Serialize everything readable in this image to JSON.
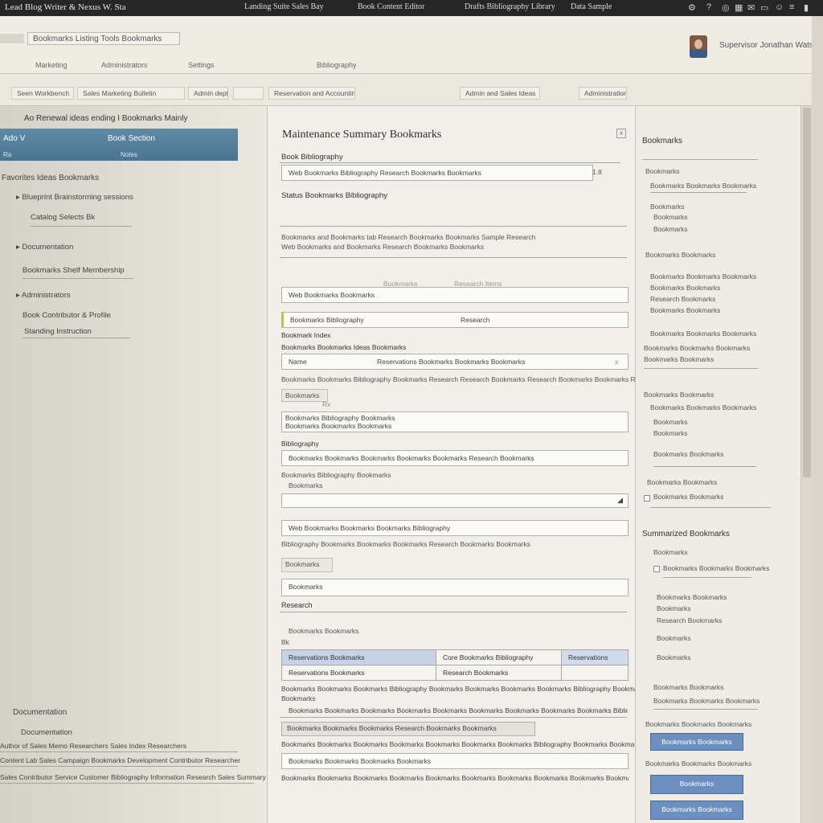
{
  "topbar": {
    "app_title": "Lead Blog Writer & Nexus W. Sta",
    "menus": [
      "Landing Suite Sales Bay",
      "Book Content Editor",
      "Drafts Bibliography Library",
      "Data Sample"
    ],
    "icons": [
      "settings-icon",
      "help-icon",
      "globe-icon",
      "grid-icon",
      "mail-icon",
      "window-icon",
      "user-icon",
      "lock-icon"
    ]
  },
  "header": {
    "search_text": "Bookmarks Listing Tools Bookmarks",
    "links": [
      "Marketing",
      "Administrators",
      "Settings",
      "Bibliography"
    ],
    "user_name": "Supervisor Jonathan Watson"
  },
  "tabs": [
    "Seen Workbench",
    "Sales Marketing Bulletin",
    "Admin dept",
    "Reservation and Accounting Tools",
    "Admin and Sales Ideas",
    "Administration Sales"
  ],
  "sidebar": {
    "title": "Ao Renewal ideas ending I Bookmarks Mainly",
    "active_primary": "Ado V",
    "active_secondary": "Book Section",
    "active_sub1": "Ra",
    "active_sub2": "Notes",
    "section_title": "Favorites Ideas Bookmarks",
    "items": [
      "Blueprint Brainstorming sessions",
      "Catalog Selects Bk",
      "Documentation",
      "Bookmarks Shelf Membership",
      "Administrators",
      "Book Contributor & Profile",
      "Standing Instruction"
    ],
    "footer_title": "Documentation",
    "footer_sub": "Documentation",
    "footer_lines": [
      "Author of Sales Memo Researchers Sales Index Researchers",
      "Content Lab Sales Campaign Bookmarks Development Contributor Researcher",
      "Sales Contributor Service Customer Bibliography Information Research Sales Summary"
    ]
  },
  "form": {
    "title": "Maintenance Summary Bookmarks",
    "close": "x",
    "label_a": "Book Bibliography",
    "field_a": "Web Bookmarks Bibliography Research Bookmarks Bookmarks",
    "field_a_suffix": "1.8",
    "label_b": "Status Bookmarks Bibliography",
    "desc_1": "Bookmarks and Bookmarks tab Research Bookmarks Bookmarks Sample Research",
    "desc_2": "Web Bookmarks and Bookmarks Research Bookmarks Bookmarks",
    "mini_1": "Bookmarks",
    "mini_2": "Research Items",
    "field_b": "Web Bookmarks Bookmarks",
    "field_c": "Bookmarks Bibliography",
    "field_c_right": "Research",
    "label_c": "Bookmark Index",
    "label_d": "Bookmarks Bookmarks Ideas Bookmarks",
    "field_d_left": "Name",
    "field_d_mid": "Reservations Bookmarks Bookmarks Bookmarks",
    "field_d_right": "x",
    "note_1": "Bookmarks Bookmarks Bibliography Bookmarks Research Research Bookmarks Research Bookmarks Bookmarks Research",
    "sub_btn": "Bookmarks",
    "subline": "Rx",
    "field_e_1": "Bookmarks Bibliography Bookmarks",
    "field_e_2": "Bookmarks Bookmarks Bookmarks",
    "label_e": "Bibliography",
    "field_f": "Bookmarks Bookmarks Bookmarks Bookmarks Bookmarks Research Bookmarks",
    "label_f1": "Bookmarks Bibliography Bookmarks",
    "label_f2": "Bookmarks",
    "field_g": "",
    "field_h": "Web Bookmarks Bookmarks Bookmarks Bibliography",
    "note_2": "Bibliography Bookmarks Bookmarks Bookmarks Research Bookmarks Bookmarks",
    "sub_btn2": "Bookmarks",
    "field_i": "Bookmarks",
    "label_g": "Research",
    "label_h": "Bookmarks Bookmarks",
    "label_h2": "Bk",
    "table": [
      [
        "Reservations Bookmarks",
        "Core Bookmarks Bibliography",
        "Reservations"
      ],
      [
        "Reservations Bookmarks",
        "Research Bookmarks",
        ""
      ]
    ],
    "para_1": "Bookmarks Bookmarks Bookmarks Bibliography Bookmarks Bookmarks Bookmarks Bookmarks Bibliography Bookmarks Bookmarks Bibliography Bookmarks Research",
    "para_1b": "Bookmarks",
    "para_2": "Bookmarks Bookmarks Bookmarks Bookmarks Bookmarks Bookmarks Bookmarks Bookmarks Bookmarks Bibliography Bookmarks Bookmarks Bookmarks Bookmarks",
    "field_j": "Bookmarks Bookmarks Bookmarks Research Bookmarks Bookmarks",
    "para_3": "Bookmarks Bookmarks Bookmarks Bookmarks Bookmarks Bookmarks Bookmarks Bibliography Bookmarks Bookmarks",
    "field_k": "Bookmarks Bookmarks Bookmarks Bookmarks",
    "para_4": "Bookmarks Bookmarks Bookmarks Bookmarks Bookmarks Bookmarks Bookmarks Bookmarks Bookmarks Bookmarks"
  },
  "right": {
    "title1": "Bookmarks",
    "r1": "Bookmarks",
    "r2": "Bookmarks Bookmarks Bookmarks",
    "r3": "Bookmarks",
    "r4": "Bookmarks",
    "r5": "Bookmarks",
    "r6": "Bookmarks Bookmarks",
    "r7": "Bookmarks Bookmarks Bookmarks",
    "r8": "Bookmarks Bookmarks",
    "r9": "Research Bookmarks",
    "r10": "Bookmarks Bookmarks",
    "r11": "Bookmarks Bookmarks Bookmarks",
    "r12": "Bookmarks Bookmarks Bookmarks",
    "r13": "Bookmarks Bookmarks",
    "r14": "Bookmarks Bookmarks",
    "r15": "Bookmarks Bookmarks Bookmarks",
    "r16": "Bookmarks",
    "r17": "Bookmarks",
    "r18": "Bookmarks Bookmarks",
    "r19": "Bookmarks Bookmarks",
    "r20": "Bookmarks Bookmarks",
    "title2": "Summarized Bookmarks",
    "s1": "Bookmarks",
    "s2": "Bookmarks Bookmarks Bookmarks",
    "s3": "Bookmarks Bookmarks",
    "s4": "Bookmarks",
    "s5": "Research Bookmarks",
    "s6": "Bookmarks",
    "s7": "Bookmarks",
    "s8": "Bookmarks Bookmarks",
    "s9": "Bookmarks Bookmarks Bookmarks",
    "btn1": "Bookmarks Bookmarks",
    "s10": "Bookmarks Bookmarks Bookmarks",
    "btn2": "Bookmarks",
    "btn3": "Bookmarks Bookmarks"
  },
  "colors": {
    "accent": "#5f8aa6",
    "button": "#6c8fbf",
    "topbar": "#262626"
  }
}
